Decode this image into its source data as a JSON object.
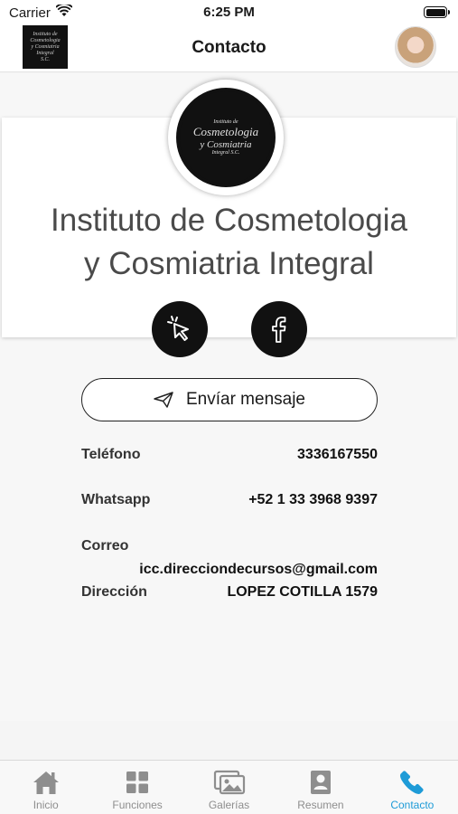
{
  "status_bar": {
    "carrier": "Carrier",
    "time": "6:25 PM"
  },
  "header": {
    "title": "Contacto",
    "logo_lines": [
      "Instituto de",
      "Cosmetologia",
      "y Cosmiatria",
      "Integral",
      "S.C."
    ]
  },
  "profile": {
    "name_line1": "Instituto de Cosmetologia",
    "name_line2": "y Cosmiatria Integral",
    "logo_lines": [
      "Instituto de",
      "Cosmetologia",
      "y Cosmiatria",
      "Integral S.C."
    ],
    "social": [
      {
        "icon": "cursor-click-icon"
      },
      {
        "icon": "facebook-icon"
      }
    ]
  },
  "actions": {
    "send_message": "Envíar mensaje"
  },
  "info": [
    {
      "label": "Teléfono",
      "value": "3336167550"
    },
    {
      "label": "Whatsapp",
      "value": "+52 1 33 3968 9397"
    },
    {
      "label": "Correo",
      "value": "icc.direcciondecursos@gmail.com"
    },
    {
      "label": "Dirección",
      "value": "LOPEZ COTILLA 1579"
    }
  ],
  "tabs": [
    {
      "label": "Inicio",
      "icon": "home-icon"
    },
    {
      "label": "Funciones",
      "icon": "grid-icon"
    },
    {
      "label": "Galerías",
      "icon": "gallery-icon"
    },
    {
      "label": "Resumen",
      "icon": "profile-card-icon"
    },
    {
      "label": "Contacto",
      "icon": "phone-icon",
      "active": true
    }
  ],
  "colors": {
    "accent": "#1e9bd7",
    "tab_inactive": "#8e8e8e",
    "dark": "#111111"
  }
}
